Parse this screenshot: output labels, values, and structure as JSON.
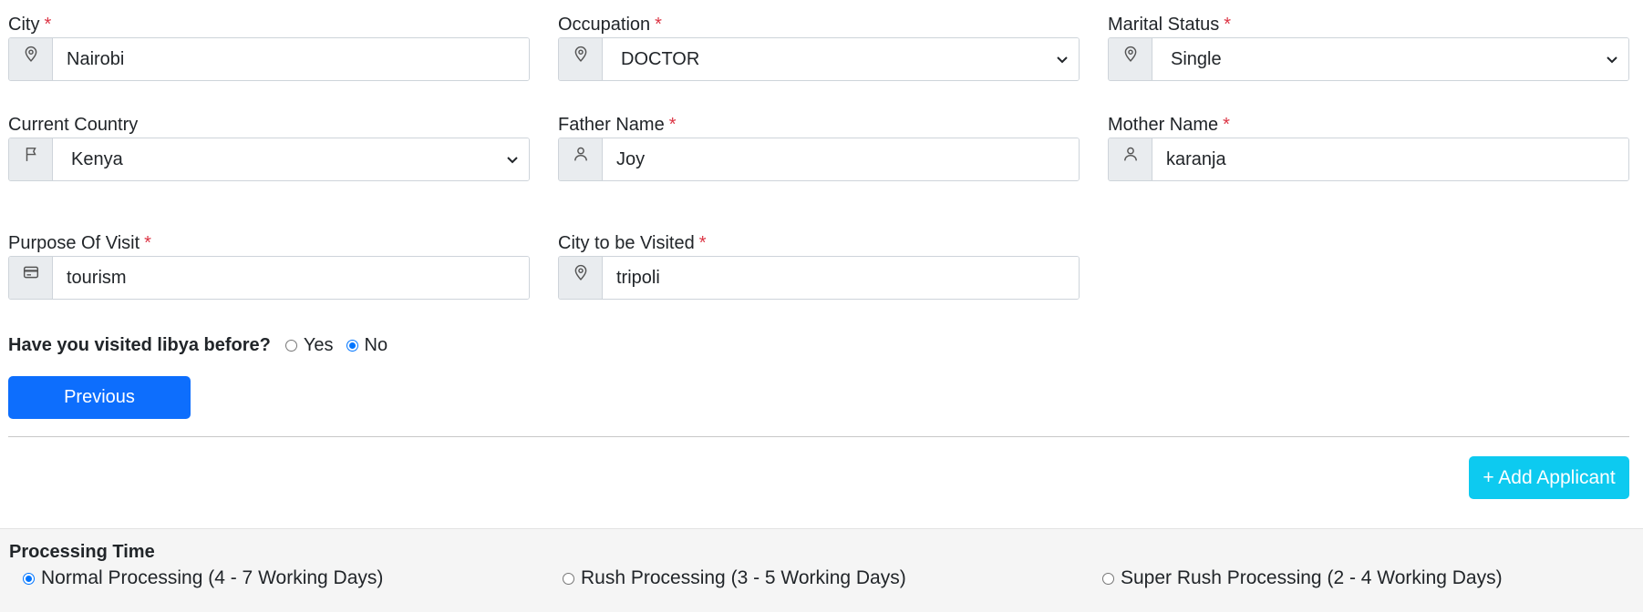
{
  "fields": {
    "city": {
      "label": "City",
      "value": "Nairobi",
      "icon": "map-pin-icon"
    },
    "occupation": {
      "label": "Occupation",
      "value": "DOCTOR",
      "icon": "map-pin-icon"
    },
    "marital_status": {
      "label": "Marital Status",
      "value": "Single",
      "icon": "map-pin-icon"
    },
    "current_country": {
      "label": "Current Country",
      "value": "Kenya",
      "icon": "flag-icon"
    },
    "father_name": {
      "label": "Father Name",
      "value": "Joy",
      "icon": "user-icon"
    },
    "mother_name": {
      "label": "Mother Name",
      "value": "karanja",
      "icon": "user-icon"
    },
    "purpose_of_visit": {
      "label": "Purpose Of Visit",
      "value": "tourism",
      "icon": "card-icon"
    },
    "city_to_visit": {
      "label": "City to be Visited",
      "value": "tripoli",
      "icon": "map-pin-icon"
    }
  },
  "required_marker": "*",
  "visited_question": {
    "text": "Have you visited libya before?",
    "options": [
      "Yes",
      "No"
    ],
    "selected": "No"
  },
  "buttons": {
    "previous": "Previous",
    "add_applicant": "+ Add Applicant"
  },
  "processing": {
    "title": "Processing Time",
    "options": [
      "Normal Processing (4 - 7 Working Days)",
      "Rush Processing (3 - 5 Working Days)",
      "Super Rush Processing (2 - 4 Working Days)"
    ],
    "selected_index": 0
  },
  "colors": {
    "primary": "#0d6efd",
    "info": "#0dcaf0",
    "required": "#dc3545",
    "radio_accent": "#0075ff"
  }
}
